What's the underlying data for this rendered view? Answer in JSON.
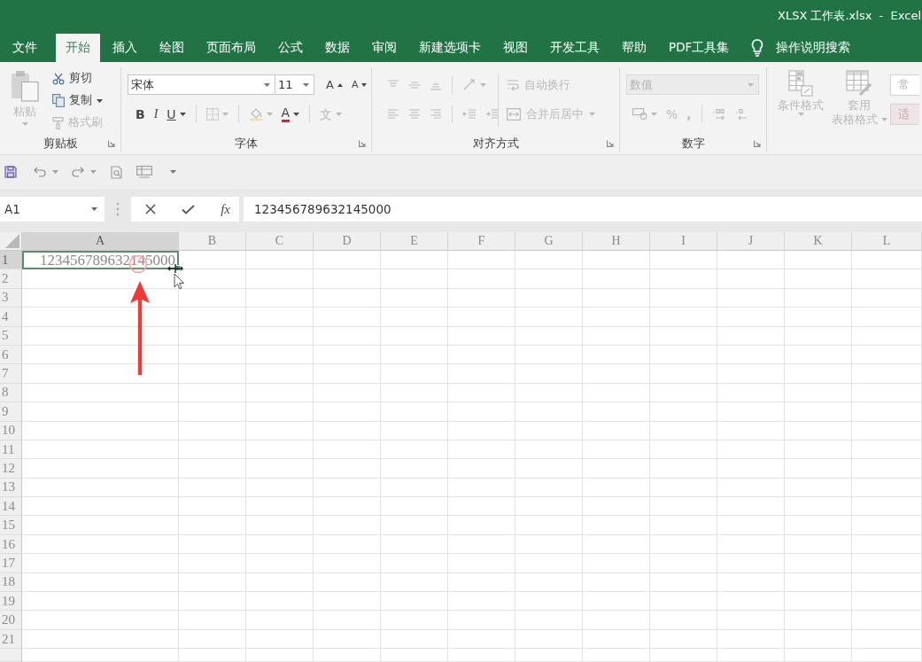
{
  "title_bar": {
    "title": "XLSX 工作表.xlsx  -  Excel"
  },
  "ribbon_tabs": [
    {
      "label": "文件",
      "selected": false
    },
    {
      "label": "开始",
      "selected": true
    },
    {
      "label": "插入",
      "selected": false
    },
    {
      "label": "绘图",
      "selected": false
    },
    {
      "label": "页面布局",
      "selected": false
    },
    {
      "label": "公式",
      "selected": false
    },
    {
      "label": "数据",
      "selected": false
    },
    {
      "label": "审阅",
      "selected": false
    },
    {
      "label": "新建选项卡",
      "selected": false
    },
    {
      "label": "视图",
      "selected": false
    },
    {
      "label": "开发工具",
      "selected": false
    },
    {
      "label": "帮助",
      "selected": false
    },
    {
      "label": "PDF工具集",
      "selected": false
    }
  ],
  "tell_me": {
    "label": "操作说明搜索"
  },
  "clipboard_group": {
    "label": "剪贴板",
    "paste": {
      "label": "粘贴",
      "disabled": true
    },
    "commands": [
      {
        "kind": "cut",
        "label": "剪切",
        "disabled": false
      },
      {
        "kind": "copy",
        "label": "复制",
        "disabled": false
      },
      {
        "kind": "format-painter",
        "label": "格式刷",
        "disabled": true
      }
    ]
  },
  "font_group": {
    "label": "字体",
    "font_name": "宋体",
    "font_size": "11",
    "size_tools": [
      {
        "kind": "grow-font",
        "label": "A",
        "disabled": false
      },
      {
        "kind": "shrink-font",
        "label": "A",
        "disabled": false
      }
    ],
    "style_tools": [
      {
        "kind": "bold",
        "label": "B",
        "disabled": false
      },
      {
        "kind": "italic",
        "label": "I",
        "disabled": false
      },
      {
        "kind": "underline",
        "label": "U",
        "disabled": false
      },
      {
        "kind": "borders",
        "disabled": true
      },
      {
        "kind": "fill-color",
        "disabled": true
      },
      {
        "kind": "font-color",
        "label": "A",
        "disabled": false
      },
      {
        "kind": "phonetic",
        "label": "文",
        "disabled": true
      }
    ]
  },
  "alignment_group": {
    "label": "对齐方式",
    "top_tools": [
      {
        "kind": "align-top",
        "disabled": true
      },
      {
        "kind": "align-middle",
        "disabled": true
      },
      {
        "kind": "align-bottom",
        "disabled": true
      },
      {
        "kind": "orientation",
        "disabled": true
      }
    ],
    "bottom_tools": [
      {
        "kind": "align-left",
        "disabled": true
      },
      {
        "kind": "align-center",
        "disabled": true
      },
      {
        "kind": "align-right",
        "disabled": true
      },
      {
        "kind": "indent-decrease",
        "disabled": true
      },
      {
        "kind": "indent-increase",
        "disabled": true
      }
    ],
    "wrap_text": {
      "label": "自动换行",
      "disabled": true
    },
    "merge_center": {
      "label": "合并后居中",
      "disabled": true
    }
  },
  "number_group": {
    "label": "数字",
    "format": {
      "value": "数值",
      "disabled": true
    },
    "tools": [
      {
        "kind": "accounting",
        "disabled": true
      },
      {
        "kind": "percent",
        "label": "%",
        "disabled": true
      },
      {
        "kind": "comma",
        "label": ",",
        "disabled": true
      },
      {
        "kind": "increase-decimal",
        "disabled": true
      },
      {
        "kind": "decrease-decimal",
        "disabled": true
      }
    ]
  },
  "styles_group": {
    "commands": [
      {
        "kind": "conditional-formatting",
        "label_lines": [
          "条件格式"
        ],
        "disabled": true
      },
      {
        "kind": "format-as-table",
        "label_lines": [
          "套用",
          "表格格式"
        ],
        "disabled": true
      }
    ],
    "cell_styles": [
      {
        "kind": "normal",
        "label": "常"
      },
      {
        "kind": "neutral",
        "label": "适"
      }
    ]
  },
  "formula_bar": {
    "name_box": "A1",
    "function_label": "fx",
    "value": "123456789632145000"
  },
  "sheet": {
    "columns": [
      {
        "label": "A",
        "selected": true
      },
      {
        "label": "B",
        "selected": false
      },
      {
        "label": "C",
        "selected": false
      },
      {
        "label": "D",
        "selected": false
      },
      {
        "label": "E",
        "selected": false
      },
      {
        "label": "F",
        "selected": false
      },
      {
        "label": "G",
        "selected": false
      },
      {
        "label": "H",
        "selected": false
      },
      {
        "label": "I",
        "selected": false
      },
      {
        "label": "J",
        "selected": false
      },
      {
        "label": "K",
        "selected": false
      },
      {
        "label": "L",
        "selected": false
      }
    ],
    "rows": [
      {
        "label": "1",
        "selected": true,
        "cells": [
          {
            "value": "123456789632145000",
            "selected": true
          }
        ]
      },
      {
        "label": "2",
        "selected": false
      },
      {
        "label": "3",
        "selected": false
      },
      {
        "label": "4",
        "selected": false
      },
      {
        "label": "5",
        "selected": false
      },
      {
        "label": "6",
        "selected": false
      },
      {
        "label": "7",
        "selected": false
      },
      {
        "label": "8",
        "selected": false
      },
      {
        "label": "9",
        "selected": false
      },
      {
        "label": "10",
        "selected": false
      },
      {
        "label": "11",
        "selected": false
      },
      {
        "label": "12",
        "selected": false
      },
      {
        "label": "13",
        "selected": false
      },
      {
        "label": "14",
        "selected": false
      },
      {
        "label": "15",
        "selected": false
      },
      {
        "label": "16",
        "selected": false
      },
      {
        "label": "17",
        "selected": false
      },
      {
        "label": "18",
        "selected": false
      },
      {
        "label": "19",
        "selected": false
      },
      {
        "label": "20",
        "selected": false
      },
      {
        "label": "21",
        "selected": false
      }
    ]
  }
}
